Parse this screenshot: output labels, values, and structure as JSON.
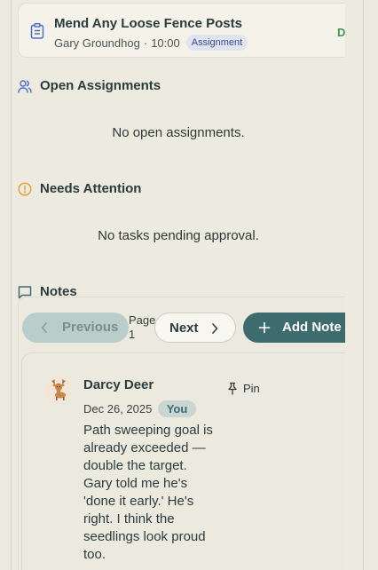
{
  "task": {
    "title": "Mend Any Loose Fence Posts",
    "assignee": "Gary Groundhog",
    "separator": "·",
    "time": "10:00",
    "type_badge": "Assignment",
    "status": "Do"
  },
  "open_assignments": {
    "title": "Open Assignments",
    "empty_text": "No open assignments."
  },
  "needs_attention": {
    "title": "Needs Attention",
    "empty_text": "No tasks pending approval."
  },
  "notes": {
    "title": "Notes",
    "prev_label": "Previous",
    "page_label": "Page",
    "page_number": "1",
    "next_label": "Next",
    "add_label": "Add Note",
    "items": [
      {
        "author": "Darcy Deer",
        "date": "Dec 26, 2025",
        "you_badge": "You",
        "pin_label": "Pin",
        "body": "Path sweeping goal is already exceeded — double the target. Gary told me he's 'done it early.' He's right. I think the seedlings look proud too."
      }
    ]
  },
  "colors": {
    "accent_teal": "#3e6b6e",
    "status_green": "#3d9a4f",
    "warning_orange": "#e8a23a",
    "icon_blue": "#4a6fc4"
  },
  "icons": {
    "task": "clipboard-icon",
    "open_assignments": "users-icon",
    "needs_attention": "alert-circle-icon",
    "notes": "message-square-icon",
    "pin": "pin-icon",
    "avatar": "deer-avatar"
  }
}
